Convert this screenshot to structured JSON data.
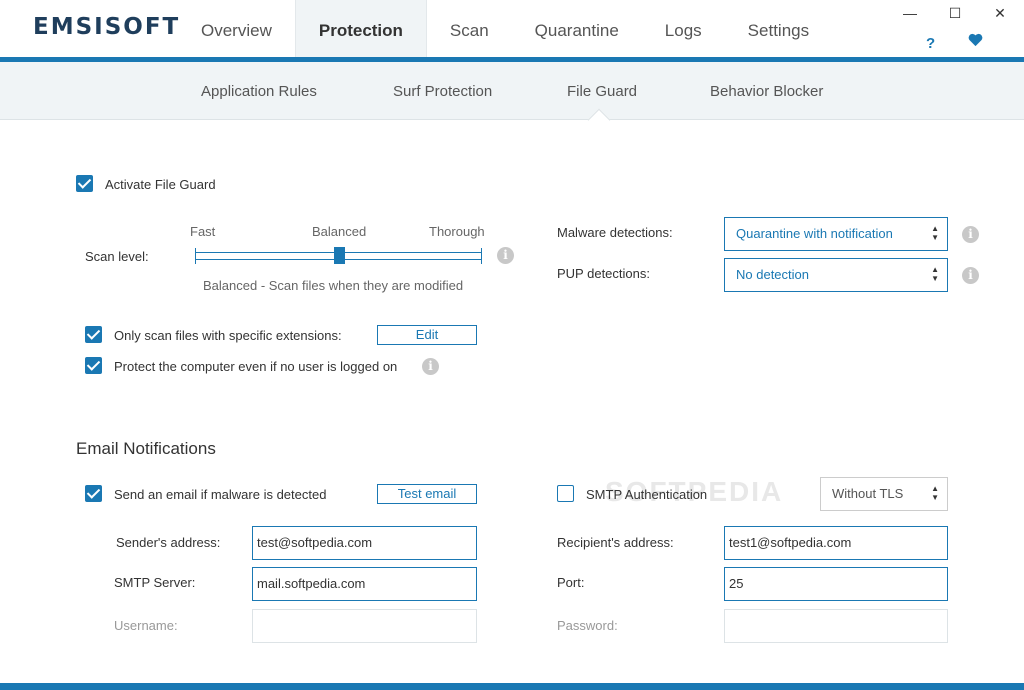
{
  "app": {
    "logo": "EMSISOFT"
  },
  "nav": {
    "tabs": [
      "Overview",
      "Protection",
      "Scan",
      "Quarantine",
      "Logs",
      "Settings"
    ],
    "active": "Protection"
  },
  "window": {
    "minimize": "—",
    "maximize": "☐",
    "close": "✕",
    "help": "?",
    "heart": "♥"
  },
  "subnav": {
    "items": [
      "Application Rules",
      "Surf Protection",
      "File Guard",
      "Behavior Blocker"
    ],
    "active": "File Guard"
  },
  "file_guard": {
    "activate_label": "Activate File Guard",
    "activate_checked": true,
    "scan_level_label": "Scan level:",
    "levels": [
      "Fast",
      "Balanced",
      "Thorough"
    ],
    "level_value": 0.5,
    "level_description": "Balanced - Scan files when they are modified",
    "malware_label": "Malware detections:",
    "malware_value": "Quarantine with notification",
    "pup_label": "PUP detections:",
    "pup_value": "No detection",
    "only_ext_label": "Only scan files with specific extensions:",
    "only_ext_checked": true,
    "edit_button": "Edit",
    "protect_label": "Protect the computer even if no user is logged on",
    "protect_checked": true
  },
  "email": {
    "section_title": "Email Notifications",
    "send_label": "Send an email if malware is detected",
    "send_checked": true,
    "test_button": "Test email",
    "smtp_auth_label": "SMTP Authentication",
    "smtp_auth_checked": false,
    "tls_value": "Without TLS",
    "sender_label": "Sender's address:",
    "sender_value": "test@softpedia.com",
    "recipient_label": "Recipient's address:",
    "recipient_value": "test1@softpedia.com",
    "server_label": "SMTP Server:",
    "server_value": "mail.softpedia.com",
    "port_label": "Port:",
    "port_value": "25",
    "username_label": "Username:",
    "username_value": "",
    "password_label": "Password:",
    "password_value": ""
  },
  "watermark": "SOFTPEDIA",
  "colors": {
    "accent": "#1a78b3",
    "subnav_bg": "#f0f4f6",
    "logo": "#1f3e5c"
  }
}
